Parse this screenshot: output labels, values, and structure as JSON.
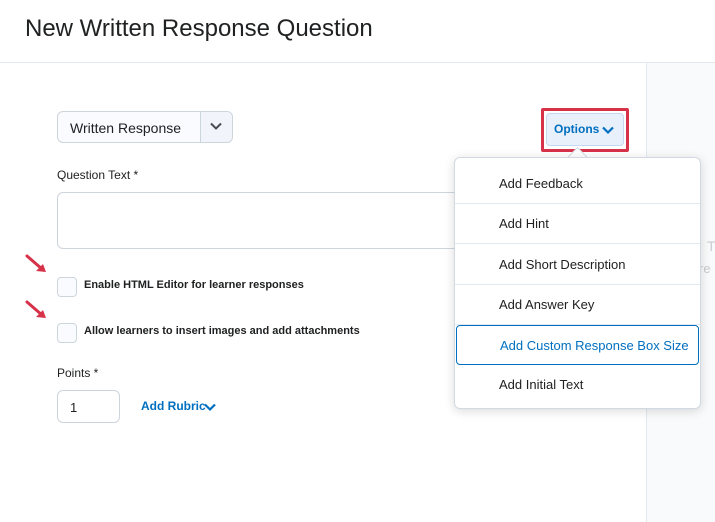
{
  "header": {
    "title": "New Written Response Question"
  },
  "right_panel": {
    "ghost_text_1": "T",
    "ghost_text_2": "re"
  },
  "question_type": {
    "selected": "Written Response"
  },
  "options_button": {
    "label": "Options"
  },
  "question_text": {
    "label": "Question Text *",
    "value": ""
  },
  "checkboxes": [
    {
      "label": "Enable HTML Editor for learner responses",
      "checked": false
    },
    {
      "label": "Allow learners to insert images and add attachments",
      "checked": false
    }
  ],
  "points": {
    "label": "Points *",
    "value": "1"
  },
  "rubric": {
    "label": "Add Rubric"
  },
  "options_menu": {
    "items": [
      {
        "label": "Add Feedback"
      },
      {
        "label": "Add Hint"
      },
      {
        "label": "Add Short Description"
      },
      {
        "label": "Add Answer Key"
      },
      {
        "label": "Add Custom Response Box Size",
        "focused": true
      },
      {
        "label": "Add Initial Text"
      }
    ]
  },
  "colors": {
    "accent": "#006fbf",
    "highlight": "#d6324a",
    "text": "#202122"
  }
}
